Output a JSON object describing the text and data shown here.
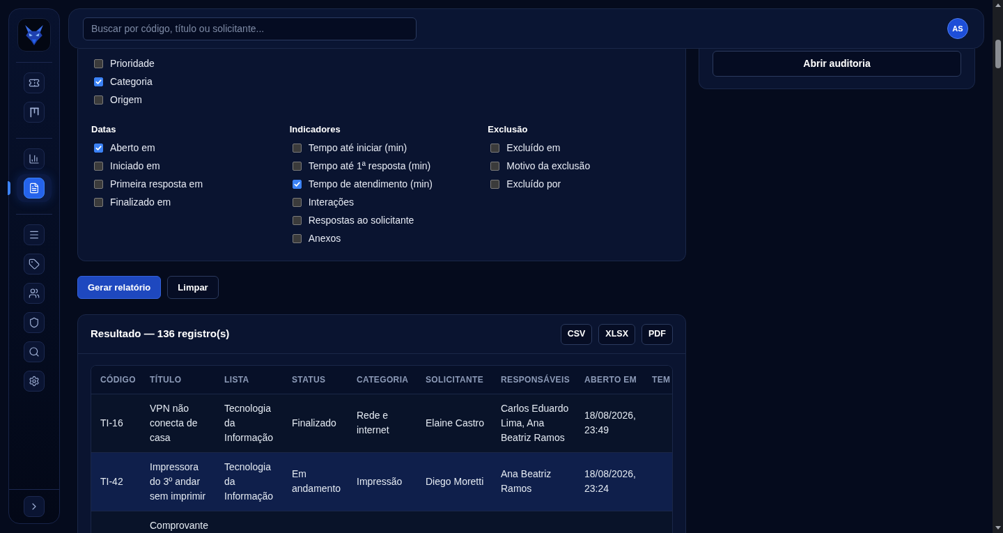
{
  "sidebar": {
    "groups": [
      {
        "items": [
          {
            "selected": false
          },
          {
            "selected": false
          }
        ]
      },
      {
        "items": [
          {
            "selected": false
          },
          {
            "selected": true
          }
        ]
      },
      {
        "items": [
          {
            "selected": false
          },
          {
            "selected": false
          },
          {
            "selected": false
          },
          {
            "selected": false
          },
          {
            "selected": false
          },
          {
            "selected": false
          }
        ]
      }
    ]
  },
  "search": {
    "placeholder": "Buscar por código, título ou solicitante..."
  },
  "user": {
    "initials": "AS"
  },
  "filters": {
    "rows": [
      [
        {
          "items": [
            {
              "label": "Prioridade",
              "checked": false
            },
            {
              "label": "Categoria",
              "checked": true
            },
            {
              "label": "Origem",
              "checked": false
            }
          ]
        }
      ],
      [
        {
          "heading": "Datas",
          "items": [
            {
              "label": "Aberto em",
              "checked": true
            },
            {
              "label": "Iniciado em",
              "checked": false
            },
            {
              "label": "Primeira resposta em",
              "checked": false
            },
            {
              "label": "Finalizado em",
              "checked": false
            }
          ]
        },
        {
          "heading": "Indicadores",
          "items": [
            {
              "label": "Tempo até iniciar (min)",
              "checked": false
            },
            {
              "label": "Tempo até 1ª resposta (min)",
              "checked": false
            },
            {
              "label": "Tempo de atendimento (min)",
              "checked": true
            },
            {
              "label": "Interações",
              "checked": false
            },
            {
              "label": "Respostas ao solicitante",
              "checked": false
            },
            {
              "label": "Anexos",
              "checked": false
            }
          ]
        },
        {
          "heading": "Exclusão",
          "items": [
            {
              "label": "Excluído em",
              "checked": false
            },
            {
              "label": "Motivo da exclusão",
              "checked": false
            },
            {
              "label": "Excluído por",
              "checked": false
            }
          ]
        }
      ]
    ]
  },
  "actions": [
    {
      "label": "Gerar relatório",
      "kind": "primary"
    },
    {
      "label": "Limpar",
      "kind": "secondary"
    }
  ],
  "audit": {
    "button": "Abrir auditoria"
  },
  "result": {
    "title": "Resultado — 136 registro(s)",
    "exports": [
      "CSV",
      "XLSX",
      "PDF"
    ],
    "table": {
      "columns": [
        "CÓDIGO",
        "TÍTULO",
        "LISTA",
        "STATUS",
        "CATEGORIA",
        "SOLICITANTE",
        "RESPONSÁVEIS",
        "ABERTO EM",
        "TEM"
      ],
      "rows": [
        {
          "selected": false,
          "cells": [
            "TI-16",
            "VPN não conecta de casa",
            "Tecnologia da Informação",
            "Finalizado",
            "Rede e internet",
            "Elaine Castro",
            "Carlos Eduardo Lima, Ana Beatriz Ramos",
            "18/08/2026, 23:49"
          ]
        },
        {
          "selected": true,
          "cells": [
            "TI-42",
            "Impressora do 3º andar sem imprimir",
            "Tecnologia da Informação",
            "Em andamento",
            "Impressão",
            "Diego Moretti",
            "Ana Beatriz Ramos",
            "18/08/2026, 23:24"
          ]
        },
        {
          "selected": false,
          "cells": [
            null,
            "Comprovante"
          ]
        }
      ]
    }
  }
}
